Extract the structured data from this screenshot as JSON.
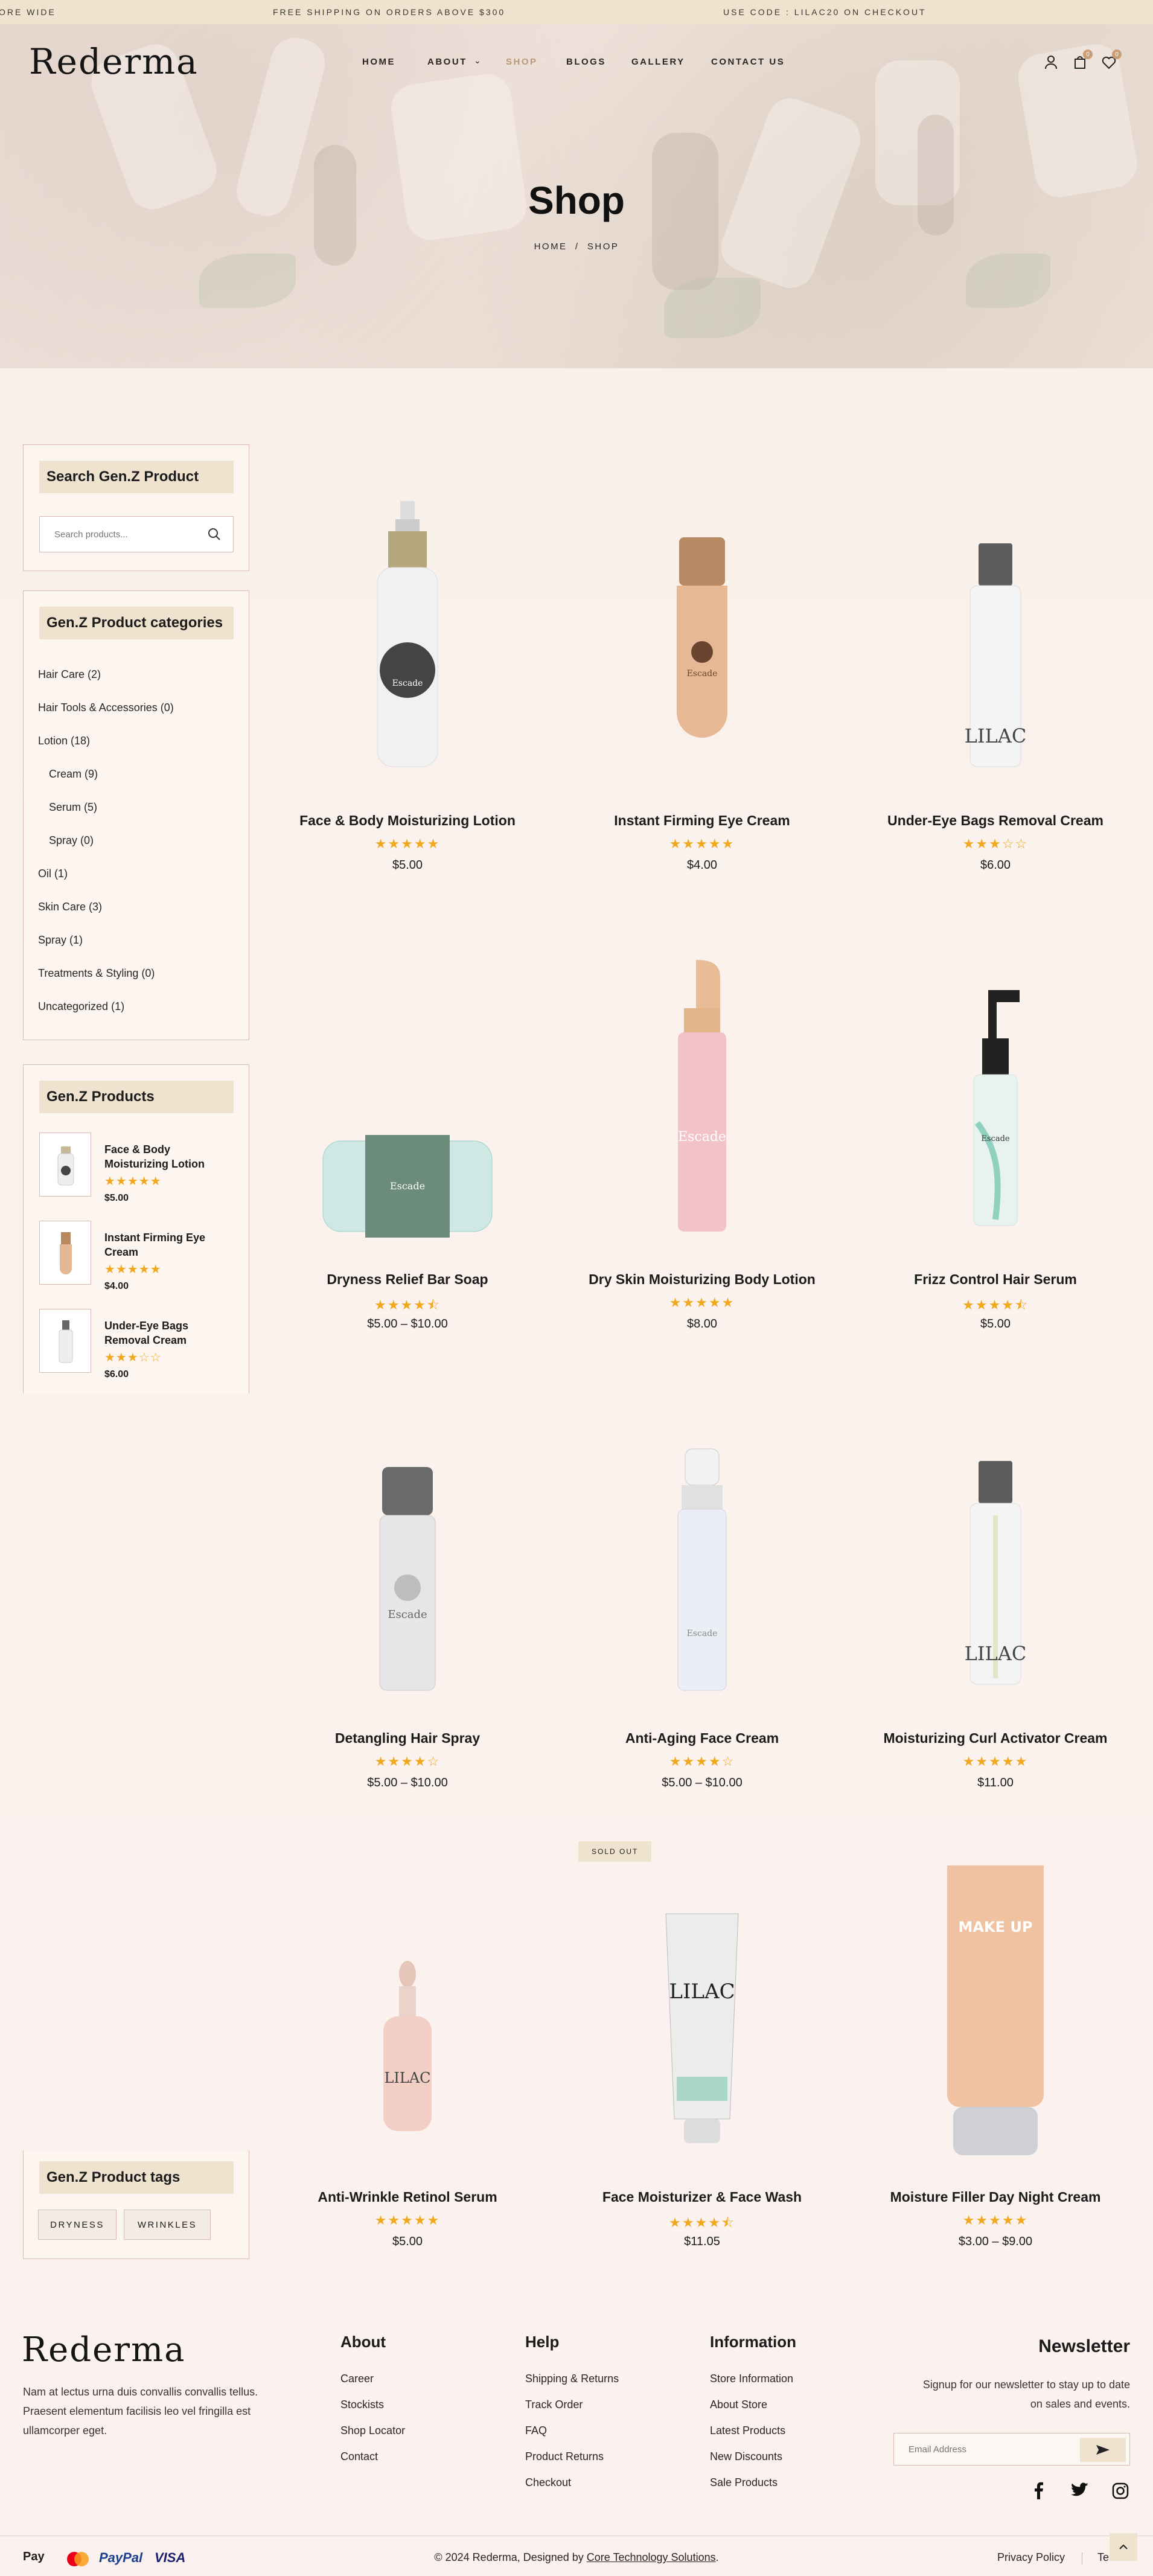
{
  "topbar": {
    "left_text": "ORE WIDE",
    "center_text": "FREE SHIPPING ON ORDERS ABOVE $300",
    "right_text": "USE CODE : LILAC20 ON CHECKOUT"
  },
  "header": {
    "logo": "Rederma",
    "nav": [
      "HOME",
      "ABOUT",
      "SHOP",
      "BLOGS",
      "GALLERY",
      "CONTACT US"
    ],
    "about_chevron": "⌄",
    "cart_count": "0",
    "wishlist_count": "0"
  },
  "hero": {
    "title": "Shop",
    "breadcrumb_home": "HOME",
    "breadcrumb_sep": "/",
    "breadcrumb_current": "SHOP"
  },
  "sidebar": {
    "search_title": "Search Gen.Z Product",
    "search_placeholder": "Search products...",
    "categories_title": "Gen.Z Product categories",
    "categories": [
      "Hair Care (2)",
      "Hair Tools & Accessories (0)",
      "Lotion (18)",
      "Cream (9)",
      "Serum (5)",
      "Spray (0)",
      "Oil (1)",
      "Skin Care (3)",
      "Spray (1)",
      "Treatments & Styling (0)",
      "Uncategorized (1)"
    ],
    "products_title": "Gen.Z Products",
    "products": [
      {
        "name": "Face & Body Moisturizing Lotion",
        "stars": "★★★★★",
        "price": "$5.00"
      },
      {
        "name": "Instant Firming Eye Cream",
        "stars": "★★★★★",
        "price": "$4.00"
      },
      {
        "name": "Under-Eye Bags Removal Cream",
        "stars": "★★★☆☆",
        "price": "$6.00"
      }
    ],
    "tags_title": "Gen.Z Product tags",
    "tags": [
      "DRYNESS",
      "WRINKLES"
    ]
  },
  "products": [
    {
      "name": "Face & Body Moisturizing Lotion",
      "stars": "★★★★★",
      "price": "$5.00"
    },
    {
      "name": "Instant Firming Eye Cream",
      "stars": "★★★★★",
      "price": "$4.00"
    },
    {
      "name": "Under-Eye Bags Removal Cream",
      "stars": "★★★☆☆",
      "price": "$6.00"
    },
    {
      "name": "Dryness Relief Bar Soap",
      "stars": "★★★★⯪",
      "price": "$5.00 – $10.00"
    },
    {
      "name": "Dry Skin Moisturizing Body Lotion",
      "stars": "★★★★★",
      "price": "$8.00"
    },
    {
      "name": "Frizz Control Hair Serum",
      "stars": "★★★★⯪",
      "price": "$5.00"
    },
    {
      "name": "Detangling Hair Spray",
      "stars": "★★★★☆",
      "price": "$5.00 – $10.00"
    },
    {
      "name": "Anti-Aging Face Cream",
      "stars": "★★★★☆",
      "price": "$5.00 – $10.00"
    },
    {
      "name": "Moisturizing Curl Activator Cream",
      "stars": "★★★★★",
      "price": "$11.00"
    },
    {
      "name": "Anti-Wrinkle Retinol Serum",
      "stars": "★★★★★",
      "price": "$5.00"
    },
    {
      "name": "Face Moisturizer & Face Wash",
      "stars": "★★★★⯪",
      "price": "$11.05",
      "badge": "SOLD OUT"
    },
    {
      "name": "Moisture Filler Day Night Cream",
      "stars": "★★★★★",
      "price": "$3.00 – $9.00"
    }
  ],
  "footer": {
    "logo": "Rederma",
    "about_text_1": "Nam at lectus urna duis convallis convallis tellus.",
    "about_text_2": "Praesent elementum facilisis leo vel fringilla est",
    "about_text_3": "ullamcorper eget.",
    "col_about": {
      "title": "About",
      "links": [
        "Career",
        "Stockists",
        "Shop Locator",
        "Contact"
      ]
    },
    "col_help": {
      "title": "Help",
      "links": [
        "Shipping & Returns",
        "Track Order",
        "FAQ",
        "Product Returns",
        "Checkout"
      ]
    },
    "col_info": {
      "title": "Information",
      "links": [
        "Store Information",
        "About Store",
        "Latest Products",
        "New Discounts",
        "Sale Products"
      ]
    },
    "newsletter_title": "Newsletter",
    "newsletter_text_1": "Signup for our newsletter to stay up to date",
    "newsletter_text_2": "on sales and events.",
    "email_placeholder": "Email Address",
    "payments": [
      "Pay",
      "PayPal",
      "VISA"
    ],
    "copyright_prefix": "© 2024 Rederma, Designed by ",
    "copyright_link": "Core Technology Solutions",
    "copyright_suffix": ".",
    "privacy": "Privacy Policy",
    "terms": "Term"
  },
  "colors": {
    "accent": "#efe3cf",
    "star": "#f0a81f",
    "border": "#d8b9ad"
  }
}
